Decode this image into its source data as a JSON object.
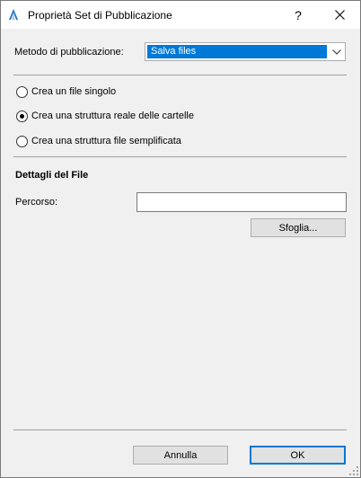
{
  "window": {
    "title": "Proprietà Set di Pubblicazione",
    "help_label": "?",
    "close_label": "✕"
  },
  "method": {
    "label": "Metodo di pubblicazione:",
    "selected": "Salva files"
  },
  "options": [
    {
      "label": "Crea un file singolo",
      "checked": false
    },
    {
      "label": "Crea una struttura reale delle cartelle",
      "checked": true
    },
    {
      "label": "Crea una struttura file semplificata",
      "checked": false
    }
  ],
  "file_details": {
    "title": "Dettagli del File",
    "path_label": "Percorso:",
    "path_value": "",
    "browse_label": "Sfoglia..."
  },
  "footer": {
    "cancel_label": "Annulla",
    "ok_label": "OK"
  },
  "colors": {
    "selection": "#0078d7",
    "dialog_bg": "#f0f0f0",
    "button_bg": "#e1e1e1"
  }
}
